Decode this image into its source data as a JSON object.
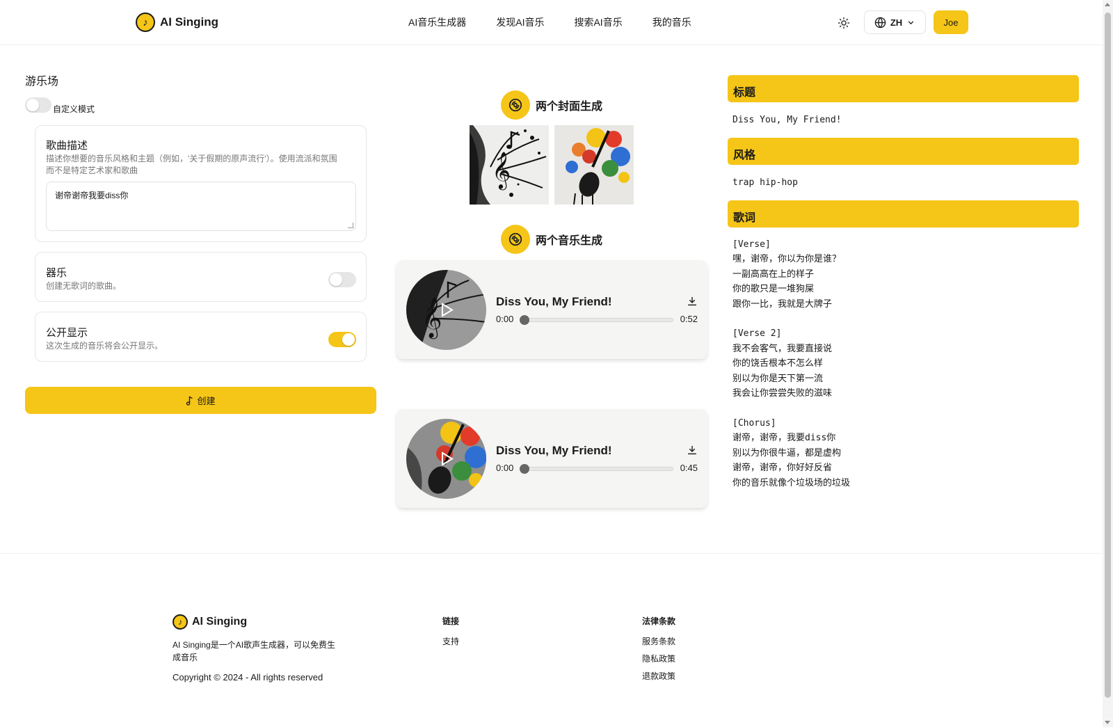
{
  "header": {
    "brand": "AI Singing",
    "nav": [
      "AI音乐生成器",
      "发现AI音乐",
      "搜索AI音乐",
      "我的音乐"
    ],
    "language": "ZH",
    "user": "Joe"
  },
  "left": {
    "title": "游乐场",
    "custom_mode_label": "自定义模式",
    "custom_mode_on": false,
    "description_card": {
      "title": "歌曲描述",
      "help_line1": "描述你想要的音乐风格和主题（例如，'关于假期的原声流行'）。使用流派和氛围",
      "help_line2": "而不是特定艺术家和歌曲",
      "value": "谢帝谢帝我要diss你"
    },
    "instrumental": {
      "title": "器乐",
      "desc": "创建无歌词的歌曲。",
      "on": false
    },
    "public": {
      "title": "公开显示",
      "desc": "这次生成的音乐将会公开显示。",
      "on": true
    },
    "create_label": "创建"
  },
  "middle": {
    "covers_heading": "两个封面生成",
    "music_heading": "两个音乐生成",
    "tracks": [
      {
        "title": "Diss You, My Friend!",
        "current": "0:00",
        "duration": "0:52",
        "progress": 0
      },
      {
        "title": "Diss You, My Friend!",
        "current": "0:00",
        "duration": "0:45",
        "progress": 0
      }
    ]
  },
  "right": {
    "title_label": "标题",
    "title_value": "Diss You, My Friend!",
    "style_label": "风格",
    "style_value": "trap hip-hop",
    "lyrics_label": "歌词",
    "lyrics": [
      "[Verse]",
      "嘿，谢帝，你以为你是谁？",
      "一副高高在上的样子",
      "你的歌只是一堆狗屎",
      "跟你一比，我就是大牌子",
      "",
      "[Verse 2]",
      "我不会客气，我要直接说",
      "你的饶舌根本不怎么样",
      "别以为你是天下第一流",
      "我会让你尝尝失败的滋味",
      "",
      "[Chorus]",
      "谢帝，谢帝，我要diss你",
      "别以为你很牛逼，都是虚构",
      "谢帝，谢帝，你好好反省",
      "你的音乐就像个垃圾场的垃圾"
    ]
  },
  "footer": {
    "brand": "AI Singing",
    "desc": "AI Singing是一个AI歌声生成器，可以免费生成音乐",
    "copyright": "Copyright © 2024 - All rights reserved",
    "links_heading": "链接",
    "links": [
      "支持"
    ],
    "legal_heading": "法律条款",
    "legal": [
      "服务条款",
      "隐私政策",
      "退款政策"
    ]
  },
  "colors": {
    "accent": "#f5c518",
    "panel": "#f5f5f4"
  }
}
